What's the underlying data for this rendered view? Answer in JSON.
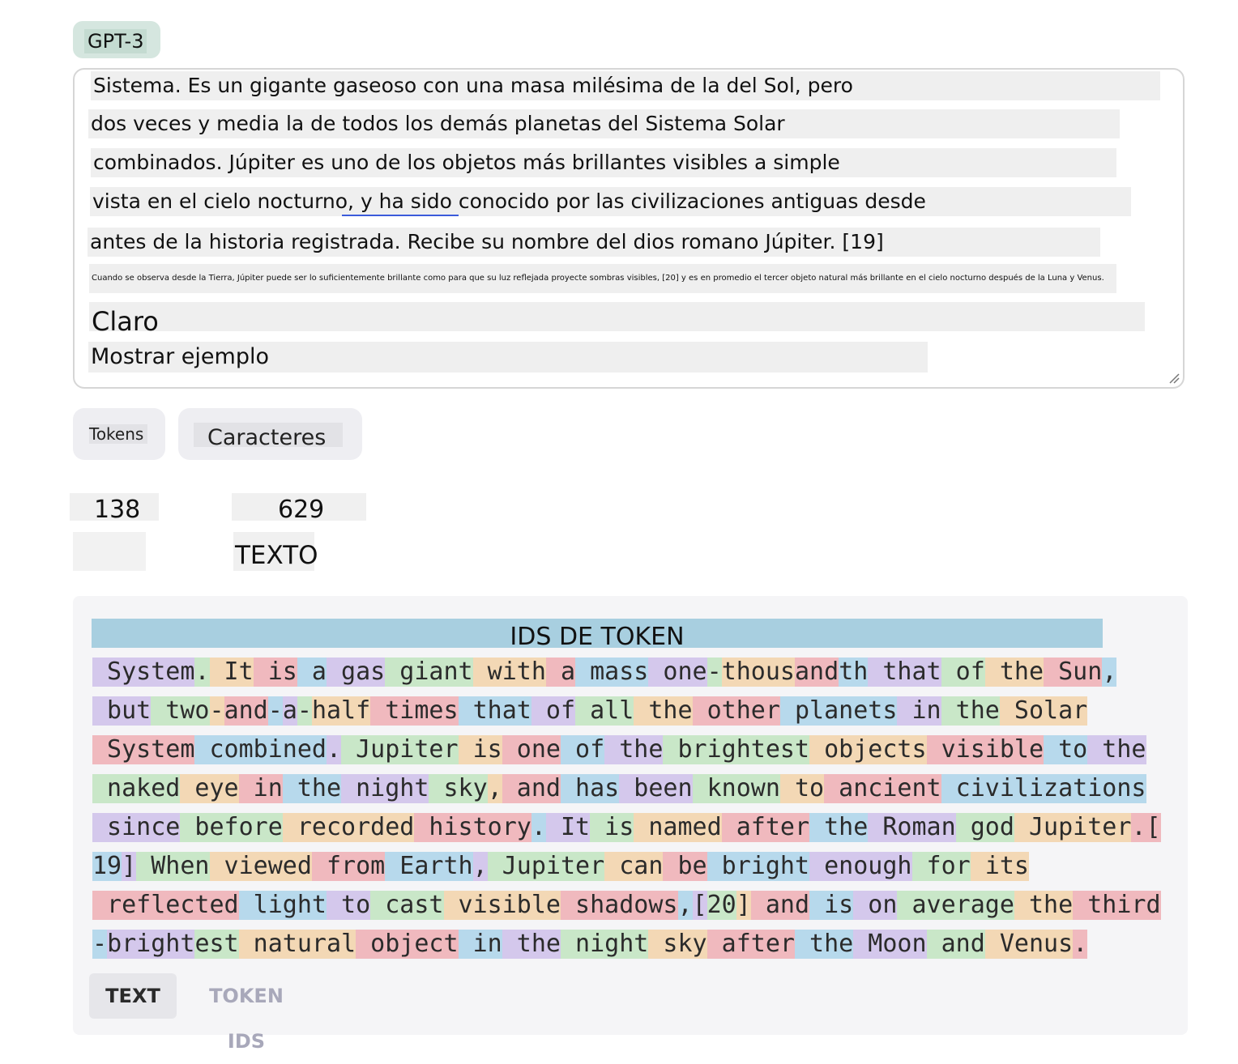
{
  "model": {
    "label": "GPT-3"
  },
  "editor": {
    "lines": [
      "Sistema. Es un gigante gaseoso con una masa milésima de la del Sol, pero",
      "dos veces y media la de todos los demás planetas del Sistema Solar",
      "combinados. Júpiter es uno de los objetos más brillantes visibles a simple",
      "vista en el cielo nocturno, y ha sido conocido por las civilizaciones antiguas desde",
      "antes de la historia registrada. Recibe su nombre del dios romano Júpiter. [19]",
      "Cuando se observa desde la Tierra, Júpiter puede ser lo suficientemente brillante como para que su luz reflejada proyecte sombras visibles, [20] y es en promedio el tercer objeto natural más brillante en el cielo nocturno después de la Luna y Venus.",
      "Claro",
      "Mostrar ejemplo"
    ]
  },
  "stats": {
    "tokens_label": "Tokens",
    "characters_label": "Caracteres",
    "tokens_value": "138",
    "characters_value": "629",
    "text_label": "TEXTO"
  },
  "token_view": {
    "heading": "IDS DE TOKEN",
    "lines": [
      [
        " System",
        ".",
        " It",
        " is",
        " a",
        " gas",
        " giant",
        " with",
        " a",
        " mass",
        " one",
        "-",
        "thous",
        "and",
        "th",
        " that",
        " of",
        " the",
        " Sun",
        ","
      ],
      [
        " but",
        " two",
        "-",
        "and",
        "-",
        "a",
        "-",
        "half",
        " times",
        " that",
        " of",
        " all",
        " the",
        " other",
        " planets",
        " in",
        " the",
        " Solar"
      ],
      [
        " System",
        " combined",
        ".",
        " Jupiter",
        " is",
        " one",
        " of",
        " the",
        " brightest",
        " objects",
        " visible",
        " to",
        " the"
      ],
      [
        " naked",
        " eye",
        " in",
        " the",
        " night",
        " sky",
        ",",
        " and",
        " has",
        " been",
        " known",
        " to",
        " ancient",
        " civilizations"
      ],
      [
        " since",
        " before",
        " recorded",
        " history",
        ".",
        " It",
        " is",
        " named",
        " after",
        " the",
        " Roman",
        " god",
        " Jupiter",
        ".["
      ],
      [
        "19",
        "]",
        " When",
        " viewed",
        " from",
        " Earth",
        ",",
        " Jupiter",
        " can",
        " be",
        " bright",
        " enough",
        " for",
        " its"
      ],
      [
        " reflected",
        " light",
        " to",
        " cast",
        " visible",
        " shadows",
        ",",
        "[",
        "20",
        "]",
        " and",
        " is",
        " on",
        " average",
        " the",
        " third"
      ],
      [
        "-",
        "bright",
        "est",
        " natural",
        " object",
        " in",
        " the",
        " night",
        " sky",
        " after",
        " the",
        " Moon",
        " and",
        " Venus",
        "."
      ]
    ]
  },
  "tabs": {
    "text": "TEXT",
    "token_ids": "TOKEN IDS"
  },
  "colors": {
    "token_palette": [
      "#d4c8ec",
      "#c9e7c8",
      "#f3d8b5",
      "#f0b9be",
      "#b7d9ec"
    ],
    "heading_band": "#a8cfe0",
    "model_pill": "#d5e6df",
    "spellcheck_underline": "#3b5bdb"
  }
}
